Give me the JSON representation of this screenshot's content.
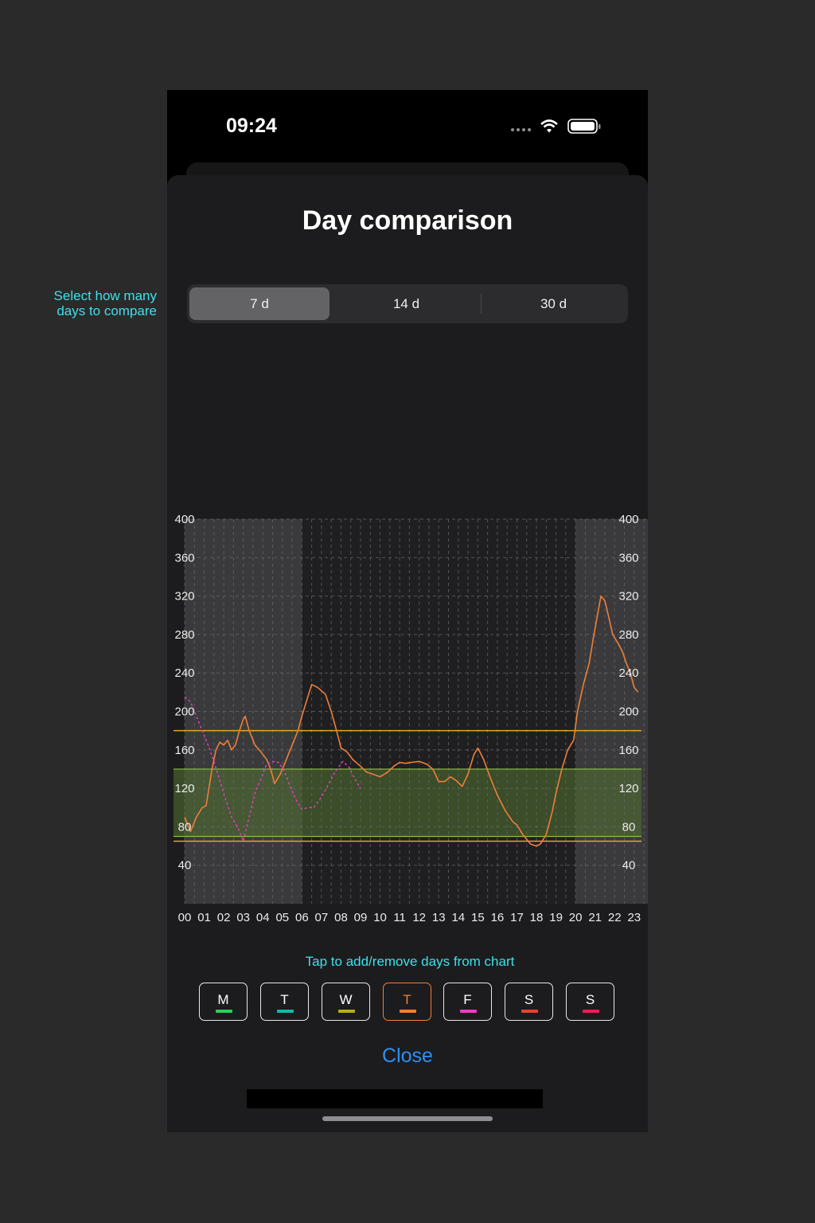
{
  "status_bar": {
    "time": "09:24"
  },
  "annotations": {
    "segment_hint": "Select how many days to compare",
    "days_hint": "Tap to add/remove days from chart"
  },
  "sheet": {
    "title": "Day comparison",
    "close_label": "Close"
  },
  "segmented": {
    "options": [
      "7 d",
      "14 d",
      "30 d"
    ],
    "selected": "7 d"
  },
  "days": [
    {
      "label": "M",
      "color": "#2fd058",
      "active": false
    },
    {
      "label": "T",
      "color": "#15b9a6",
      "active": false
    },
    {
      "label": "W",
      "color": "#b6ad1c",
      "active": false
    },
    {
      "label": "T",
      "color": "#ef7f38",
      "active": true
    },
    {
      "label": "F",
      "color": "#e93ec9",
      "active": false
    },
    {
      "label": "S",
      "color": "#e8442c",
      "active": false
    },
    {
      "label": "S",
      "color": "#e22356",
      "active": false
    }
  ],
  "chart_data": {
    "type": "line",
    "x_ticks": [
      "00",
      "01",
      "02",
      "03",
      "04",
      "05",
      "06",
      "07",
      "08",
      "09",
      "10",
      "11",
      "12",
      "13",
      "14",
      "15",
      "16",
      "17",
      "18",
      "19",
      "20",
      "21",
      "22",
      "23"
    ],
    "y_ticks": [
      40,
      80,
      120,
      160,
      200,
      240,
      280,
      320,
      360,
      400
    ],
    "ylim": [
      0,
      400
    ],
    "xlim": [
      0,
      23.7
    ],
    "grid": true,
    "night_shading_hours": [
      [
        0,
        6
      ],
      [
        20,
        23.7
      ]
    ],
    "target_range": [
      70,
      140
    ],
    "limit_lines": [
      65,
      180
    ],
    "colors": {
      "target_band": "#4e6d2f",
      "limit_line": "#e7a51f",
      "target_line": "#8fbf45"
    },
    "series": [
      {
        "color": "#ef7f38",
        "style": "solid",
        "points": [
          [
            0.0,
            90
          ],
          [
            0.3,
            75
          ],
          [
            0.6,
            90
          ],
          [
            0.9,
            100
          ],
          [
            1.1,
            102
          ],
          [
            1.4,
            140
          ],
          [
            1.6,
            160
          ],
          [
            1.8,
            168
          ],
          [
            2.0,
            165
          ],
          [
            2.2,
            170
          ],
          [
            2.4,
            160
          ],
          [
            2.6,
            165
          ],
          [
            2.8,
            180
          ],
          [
            3.0,
            192
          ],
          [
            3.1,
            195
          ],
          [
            3.3,
            180
          ],
          [
            3.6,
            165
          ],
          [
            3.9,
            158
          ],
          [
            4.2,
            150
          ],
          [
            4.4,
            140
          ],
          [
            4.6,
            125
          ],
          [
            4.9,
            135
          ],
          [
            5.2,
            150
          ],
          [
            5.5,
            165
          ],
          [
            5.8,
            180
          ],
          [
            6.0,
            195
          ],
          [
            6.3,
            215
          ],
          [
            6.5,
            228
          ],
          [
            6.8,
            225
          ],
          [
            7.2,
            218
          ],
          [
            7.5,
            200
          ],
          [
            7.8,
            178
          ],
          [
            8.0,
            162
          ],
          [
            8.3,
            158
          ],
          [
            8.6,
            150
          ],
          [
            9.0,
            143
          ],
          [
            9.3,
            137
          ],
          [
            9.6,
            135
          ],
          [
            10.0,
            132
          ],
          [
            10.4,
            137
          ],
          [
            10.7,
            143
          ],
          [
            11.0,
            147
          ],
          [
            11.3,
            146
          ],
          [
            11.6,
            147
          ],
          [
            12.0,
            148
          ],
          [
            12.4,
            145
          ],
          [
            12.7,
            140
          ],
          [
            13.0,
            127
          ],
          [
            13.3,
            127
          ],
          [
            13.6,
            132
          ],
          [
            13.9,
            128
          ],
          [
            14.2,
            122
          ],
          [
            14.5,
            135
          ],
          [
            14.8,
            155
          ],
          [
            15.0,
            162
          ],
          [
            15.3,
            150
          ],
          [
            15.6,
            133
          ],
          [
            16.0,
            113
          ],
          [
            16.4,
            97
          ],
          [
            16.8,
            85
          ],
          [
            17.0,
            82
          ],
          [
            17.3,
            72
          ],
          [
            17.7,
            62
          ],
          [
            18.0,
            60
          ],
          [
            18.2,
            62
          ],
          [
            18.5,
            72
          ],
          [
            18.8,
            95
          ],
          [
            19.0,
            115
          ],
          [
            19.3,
            140
          ],
          [
            19.6,
            160
          ],
          [
            19.9,
            170
          ],
          [
            20.1,
            200
          ],
          [
            20.4,
            228
          ],
          [
            20.7,
            250
          ],
          [
            20.9,
            275
          ],
          [
            21.1,
            298
          ],
          [
            21.3,
            320
          ],
          [
            21.5,
            315
          ],
          [
            21.7,
            298
          ],
          [
            21.9,
            280
          ],
          [
            22.2,
            270
          ],
          [
            22.4,
            262
          ],
          [
            22.6,
            250
          ],
          [
            22.8,
            240
          ],
          [
            23.0,
            225
          ],
          [
            23.2,
            220
          ]
        ]
      },
      {
        "color": "#e93ec9",
        "style": "dashed",
        "points": [
          [
            0.0,
            215
          ],
          [
            0.3,
            210
          ],
          [
            0.6,
            195
          ],
          [
            0.9,
            180
          ],
          [
            1.2,
            165
          ],
          [
            1.5,
            148
          ],
          [
            1.8,
            128
          ],
          [
            2.1,
            108
          ],
          [
            2.4,
            90
          ],
          [
            2.7,
            80
          ],
          [
            3.0,
            65
          ],
          [
            3.3,
            90
          ],
          [
            3.6,
            115
          ],
          [
            3.9,
            130
          ],
          [
            4.2,
            145
          ],
          [
            4.5,
            148
          ],
          [
            4.8,
            147
          ],
          [
            5.1,
            138
          ],
          [
            5.4,
            122
          ],
          [
            5.7,
            108
          ],
          [
            6.0,
            98
          ],
          [
            6.3,
            100
          ],
          [
            6.6,
            100
          ],
          [
            6.9,
            108
          ],
          [
            7.2,
            118
          ],
          [
            7.5,
            130
          ],
          [
            7.8,
            140
          ],
          [
            8.1,
            148
          ],
          [
            8.4,
            142
          ],
          [
            8.7,
            130
          ],
          [
            9.0,
            120
          ]
        ]
      }
    ]
  }
}
